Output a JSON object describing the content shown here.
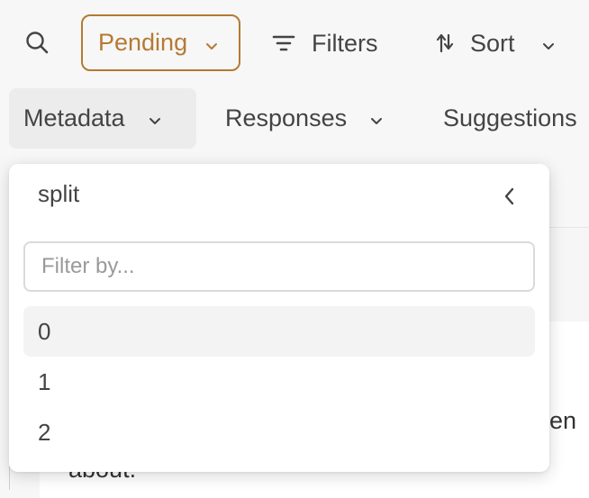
{
  "toolbar": {
    "search_icon": "search-icon",
    "status_label": "Pending",
    "filters_label": "Filters",
    "sort_label": "Sort"
  },
  "tabs": {
    "metadata_label": "Metadata",
    "responses_label": "Responses",
    "suggestions_label": "Suggestions"
  },
  "dropdown": {
    "title": "split",
    "filter_placeholder": "Filter by...",
    "options": [
      "0",
      "1",
      "2"
    ],
    "active_index": 0
  },
  "background": {
    "text_fragment_1": "en",
    "text_fragment_2": "about."
  },
  "colors": {
    "accent": "#b47a33",
    "page_bg": "#f7f7f7",
    "active_tab_bg": "#ececec",
    "active_option_bg": "#f3f3f3"
  }
}
